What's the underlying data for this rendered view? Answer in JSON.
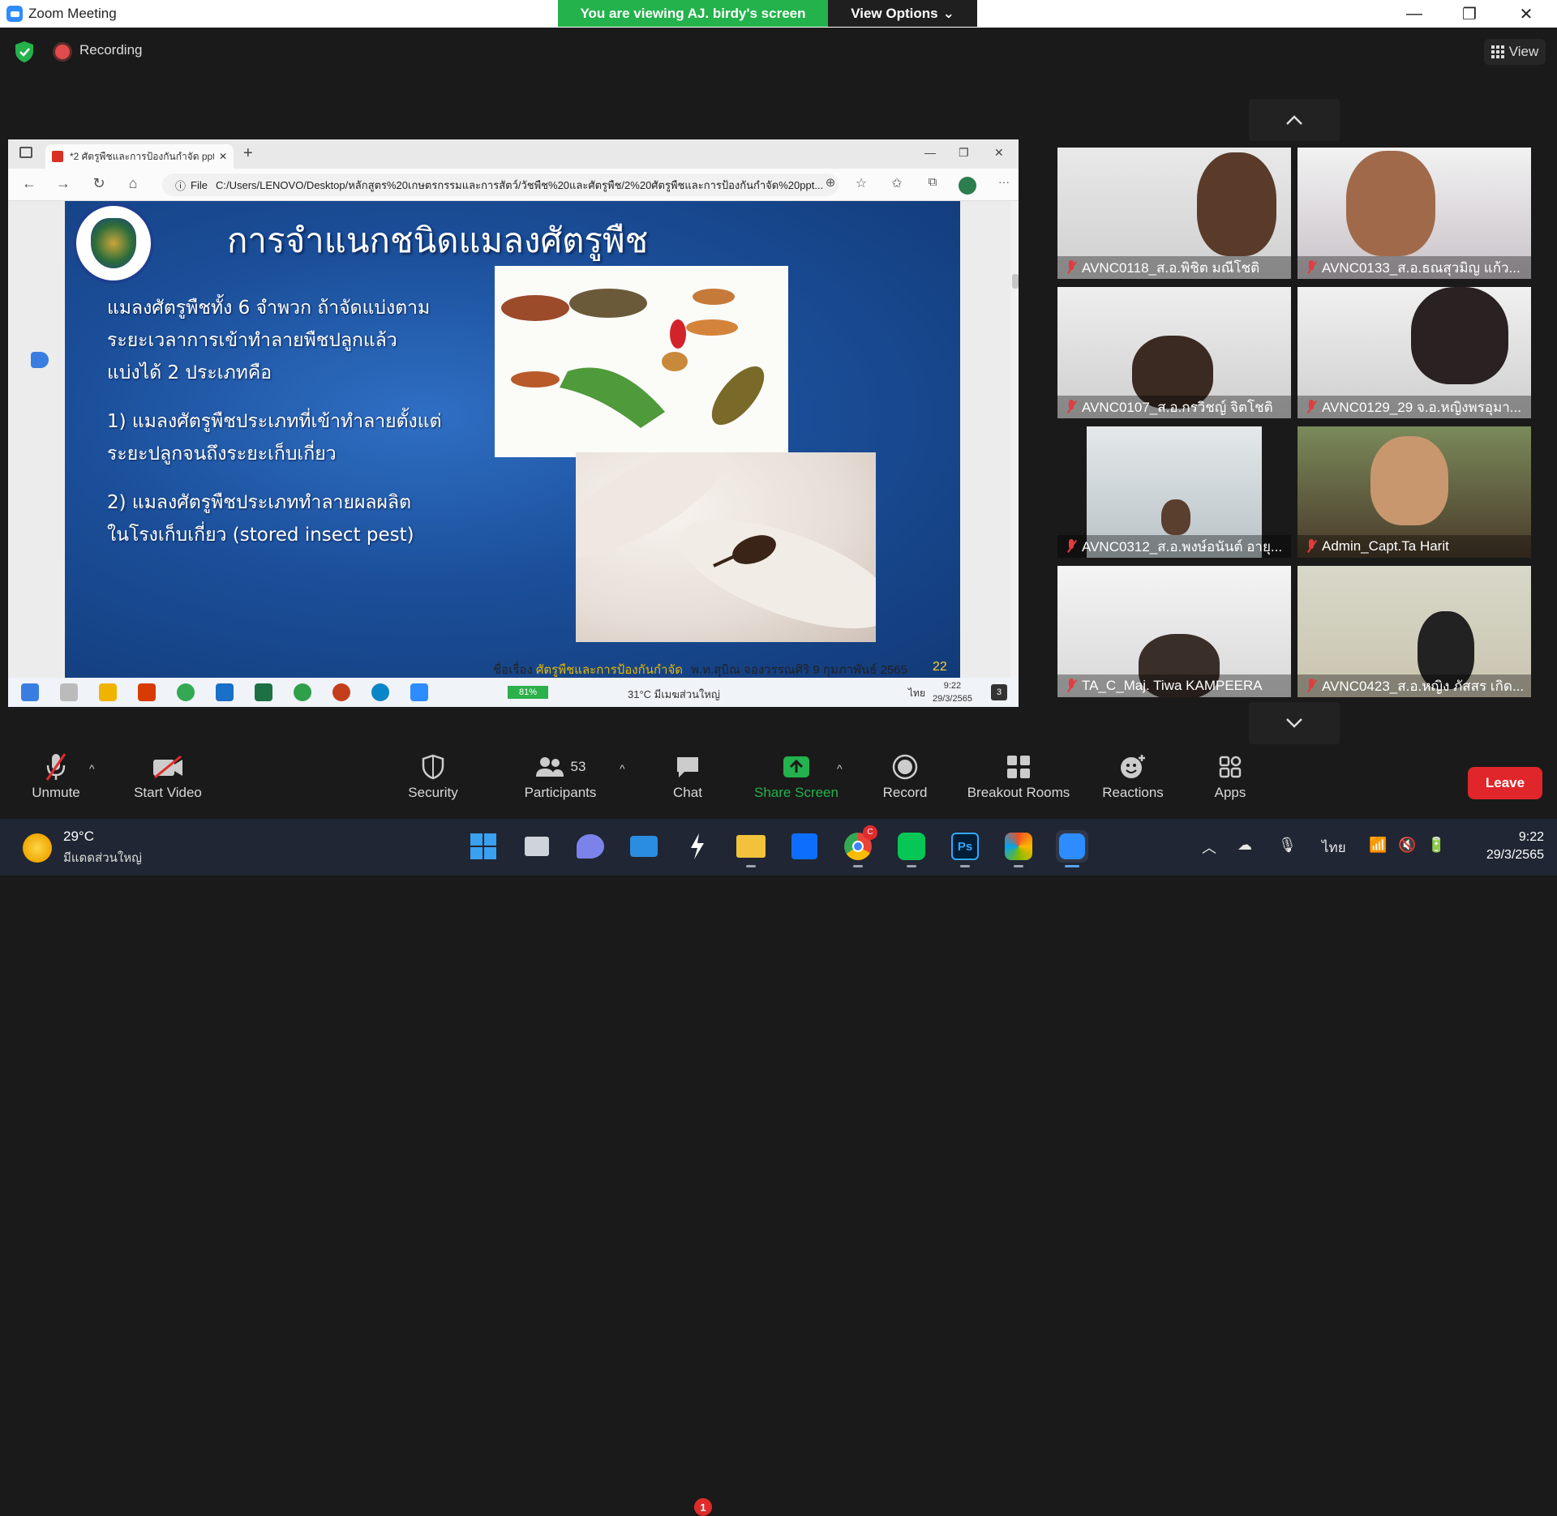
{
  "window": {
    "title": "Zoom Meeting",
    "banner": "You are viewing AJ. birdy's screen",
    "view_options": "View Options",
    "view_options_caret": "⌄",
    "minimize": "—",
    "maximize": "❐",
    "close": "✕"
  },
  "meeting": {
    "recording_label": "Recording",
    "view_label": "View"
  },
  "browser": {
    "tab_title": "*2 ศัตรูพืชและการป้องกันกำจัด ppt.p",
    "tab_close": "✕",
    "new_tab": "+",
    "file_label": "File",
    "url": "C:/Users/LENOVO/Desktop/หลักสูตร%20เกษตรกรรมและการสัตว์/วัชพืช%20และศัตรูพืช/2%20ศัตรูพืชและการป้องกันกำจัด%20ppt...",
    "zoom_glyph": "⊕",
    "more": "···"
  },
  "slide": {
    "title": "การจำแนกชนิดแมลงศัตรูพืช",
    "intro": [
      "แมลงศัตรูพืชทั้ง 6 จำพวก ถ้าจัดแบ่งตาม",
      "ระยะเวลาการเข้าทำลายพืชปลูกแล้ว",
      "แบ่งได้ 2 ประเภทคือ"
    ],
    "item1": [
      "1) แมลงศัตรูพืชประเภทที่เข้าทำลายตั้งแต่",
      "ระยะปลูกจนถึงระยะเก็บเกี่ยว"
    ],
    "item2": [
      "2) แมลงศัตรูพืชประเภททำลายผลผลิต",
      "ในโรงเก็บเกี่ยว (stored insect pest)"
    ],
    "footer_prefix": "ชื่อเรื่อง",
    "footer_topic": "ศัตรูพืชและการป้องกันกำจัด",
    "footer_author": "พ.ท.สุบิณ  จองวรรณศิริ  9 กุมภาพันธ์ 2565",
    "page": "22"
  },
  "shared_taskbar": {
    "battery": "81%",
    "weather": "31°C  มีเมฆส่วนใหญ่",
    "lang": "ไทย",
    "time": "9:22",
    "date": "29/3/2565",
    "notif": "3"
  },
  "participants": [
    {
      "name": "AVNC0118_ส.อ.พิชิต มณีโชติ",
      "muted": true
    },
    {
      "name": "AVNC0133_ส.อ.ธณสุวมิญ  แก้ว...",
      "muted": true
    },
    {
      "name": "AVNC0107_ส.อ.กรวิชญ์ จิตโชติ",
      "muted": true
    },
    {
      "name": "AVNC0129_29 จ.อ.หญิงพรอุมา...",
      "muted": true
    },
    {
      "name": "AVNC0312_ส.อ.พงษ์อนันต์ อายุ...",
      "muted": true
    },
    {
      "name": "Admin_Capt.Ta Harit",
      "muted": true
    },
    {
      "name": "TA_C_Maj. Tiwa KAMPEERA",
      "muted": true
    },
    {
      "name": "AVNC0423_ส.อ.หญิง ภัสสร เกิด...",
      "muted": true
    }
  ],
  "toolbar": {
    "unmute": "Unmute",
    "start_video": "Start Video",
    "security": "Security",
    "participants": "Participants",
    "participants_count": "53",
    "chat": "Chat",
    "chat_badge": "1",
    "share_screen": "Share Screen",
    "record": "Record",
    "breakout": "Breakout Rooms",
    "reactions": "Reactions",
    "apps": "Apps",
    "leave": "Leave",
    "caret": "^"
  },
  "taskbar": {
    "temp": "29°C",
    "weather_desc": "มีแดดส่วนใหญ่",
    "chrome_badge": "C",
    "lang": "ไทย",
    "time": "9:22",
    "date": "29/3/2565"
  },
  "colors": {
    "banner_green": "#23b24b",
    "share_green": "#23b24b",
    "leave_red": "#e0262b",
    "badge_red": "#e02b2b"
  }
}
